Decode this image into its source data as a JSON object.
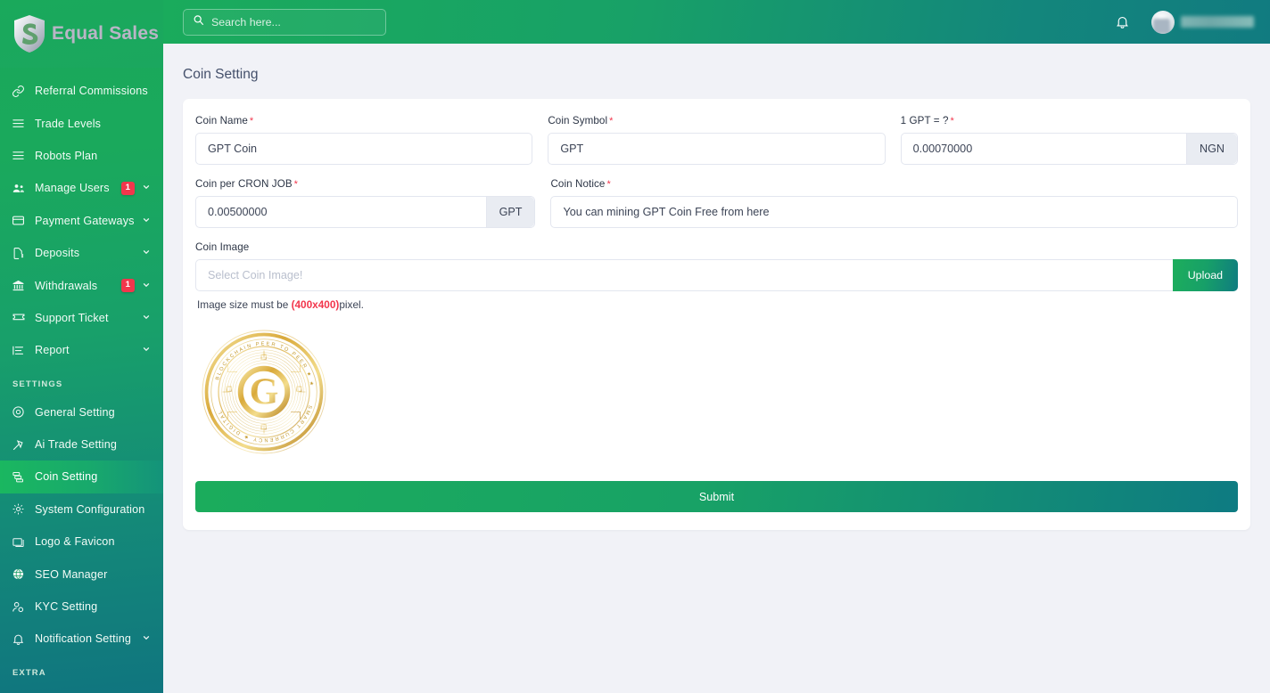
{
  "brand": {
    "name": "Equal Sales",
    "logo_icon": "shield-s-logo"
  },
  "search": {
    "placeholder": "Search here...",
    "value": "",
    "icon": "search-icon"
  },
  "topbar": {
    "bell_icon": "bell-icon",
    "avatar_icon": "avatar",
    "username": ""
  },
  "sidebar": {
    "items": [
      {
        "label": "Referral Commissions",
        "icon": "link-icon",
        "badge": "",
        "chevron": false,
        "active": false
      },
      {
        "label": "Trade Levels",
        "icon": "list-icon",
        "badge": "",
        "chevron": false,
        "active": false
      },
      {
        "label": "Robots Plan",
        "icon": "list-icon",
        "badge": "",
        "chevron": false,
        "active": false
      },
      {
        "label": "Manage Users",
        "icon": "users-gear-icon",
        "badge": "1",
        "chevron": true,
        "active": false
      },
      {
        "label": "Payment Gateways",
        "icon": "credit-card-icon",
        "badge": "",
        "chevron": true,
        "active": false
      },
      {
        "label": "Deposits",
        "icon": "document-dollar-icon",
        "badge": "",
        "chevron": true,
        "active": false
      },
      {
        "label": "Withdrawals",
        "icon": "bank-icon",
        "badge": "1",
        "chevron": true,
        "active": false
      },
      {
        "label": "Support Ticket",
        "icon": "ticket-icon",
        "badge": "",
        "chevron": true,
        "active": false
      },
      {
        "label": "Report",
        "icon": "report-list-icon",
        "badge": "",
        "chevron": true,
        "active": false
      }
    ],
    "settings_section": "SETTINGS",
    "settings_items": [
      {
        "label": "General Setting",
        "icon": "disc-icon",
        "badge": "",
        "chevron": false,
        "active": false
      },
      {
        "label": "Ai Trade Setting",
        "icon": "hammer-icon",
        "badge": "",
        "chevron": false,
        "active": false
      },
      {
        "label": "Coin Setting",
        "icon": "coins-stack-icon",
        "badge": "",
        "chevron": false,
        "active": true
      },
      {
        "label": "System Configuration",
        "icon": "gear-icon",
        "badge": "",
        "chevron": false,
        "active": false
      },
      {
        "label": "Logo & Favicon",
        "icon": "image-icon",
        "badge": "",
        "chevron": false,
        "active": false
      },
      {
        "label": "SEO Manager",
        "icon": "globe-icon",
        "badge": "",
        "chevron": false,
        "active": false
      },
      {
        "label": "KYC Setting",
        "icon": "user-check-icon",
        "badge": "",
        "chevron": false,
        "active": false
      },
      {
        "label": "Notification Setting",
        "icon": "bell-icon",
        "badge": "",
        "chevron": true,
        "active": false
      }
    ],
    "extra_section": "EXTRA"
  },
  "page": {
    "title": "Coin Setting"
  },
  "form": {
    "coin_name": {
      "label": "Coin Name",
      "required": "*",
      "value": "GPT Coin",
      "placeholder": ""
    },
    "coin_symbol": {
      "label": "Coin Symbol",
      "required": "*",
      "value": "GPT",
      "placeholder": ""
    },
    "rate": {
      "label": "1 GPT = ?",
      "required": "*",
      "value": "0.00070000",
      "placeholder": "",
      "suffix": "NGN"
    },
    "coin_per_cron": {
      "label": "Coin per CRON JOB",
      "required": "*",
      "value": "0.00500000",
      "placeholder": "",
      "suffix": "GPT"
    },
    "coin_notice": {
      "label": "Coin Notice",
      "required": "*",
      "value": "You can mining GPT Coin Free from here",
      "placeholder": ""
    },
    "coin_image": {
      "label": "Coin Image",
      "value": "",
      "placeholder": "Select Coin Image!",
      "upload_label": "Upload",
      "hint_before": "Image size must be ",
      "hint_strong": "(400x400)",
      "hint_after": "pixel.",
      "preview_icon": "gpt-coin-logo"
    },
    "submit_label": "Submit"
  },
  "colors": {
    "brand_green": "#1aab5c",
    "teal": "#0f7c80",
    "danger": "#f2364c",
    "page_bg": "#f1f2f7",
    "text": "#3c4456"
  }
}
